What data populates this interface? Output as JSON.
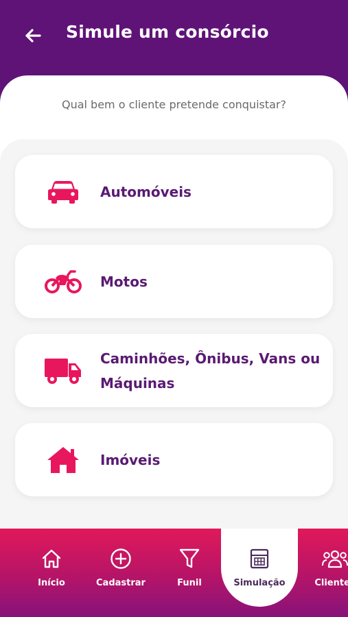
{
  "header": {
    "title": "Simule um consórcio",
    "back_icon": "arrow-left-icon"
  },
  "question": "Qual bem o cliente pretende conquistar?",
  "options": [
    {
      "label": "Automóveis",
      "icon": "car-icon"
    },
    {
      "label": "Motos",
      "icon": "motorcycle-icon"
    },
    {
      "label": "Caminhões, Ônibus, Vans ou Máquinas",
      "icon": "truck-icon"
    },
    {
      "label": "Imóveis",
      "icon": "house-icon"
    }
  ],
  "nav": {
    "items": [
      {
        "label": "Início",
        "icon": "home-icon"
      },
      {
        "label": "Cadastrar",
        "icon": "plus-circle-icon"
      },
      {
        "label": "Funil",
        "icon": "funnel-icon"
      },
      {
        "label": "Simulação",
        "icon": "calculator-icon",
        "active": true
      },
      {
        "label": "Clientes",
        "icon": "users-icon"
      }
    ]
  },
  "colors": {
    "header_bg": "#5f1377",
    "accent_pink": "#e8175d",
    "label_purple": "#5a1a72",
    "nav_gradient_top": "#e0195a",
    "nav_gradient_bottom": "#86137a"
  }
}
